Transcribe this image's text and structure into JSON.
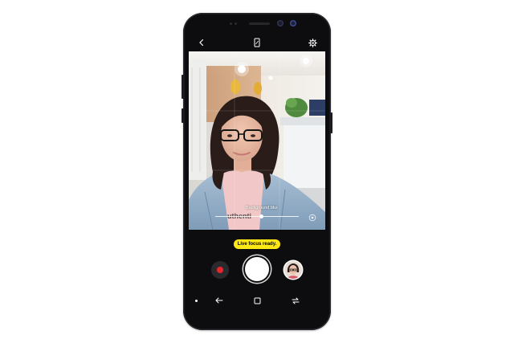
{
  "camera": {
    "toast": "Live focus ready.",
    "blur_label": "Background blur",
    "blur_level": 0.55
  },
  "icons": {
    "back": "back-arrow-icon",
    "ratio": "aspect-ratio-icon",
    "settings": "gear-icon",
    "effect": "live-focus-effect-icon",
    "record": "record-icon",
    "gallery": "gallery-thumbnail-icon",
    "nav_back": "nav-back-icon",
    "nav_home": "nav-home-icon",
    "nav_recents": "nav-recents-icon"
  },
  "colors": {
    "toast_bg": "#ffe815",
    "record_dot": "#e8262b",
    "phone_body": "#0d0d0f"
  }
}
